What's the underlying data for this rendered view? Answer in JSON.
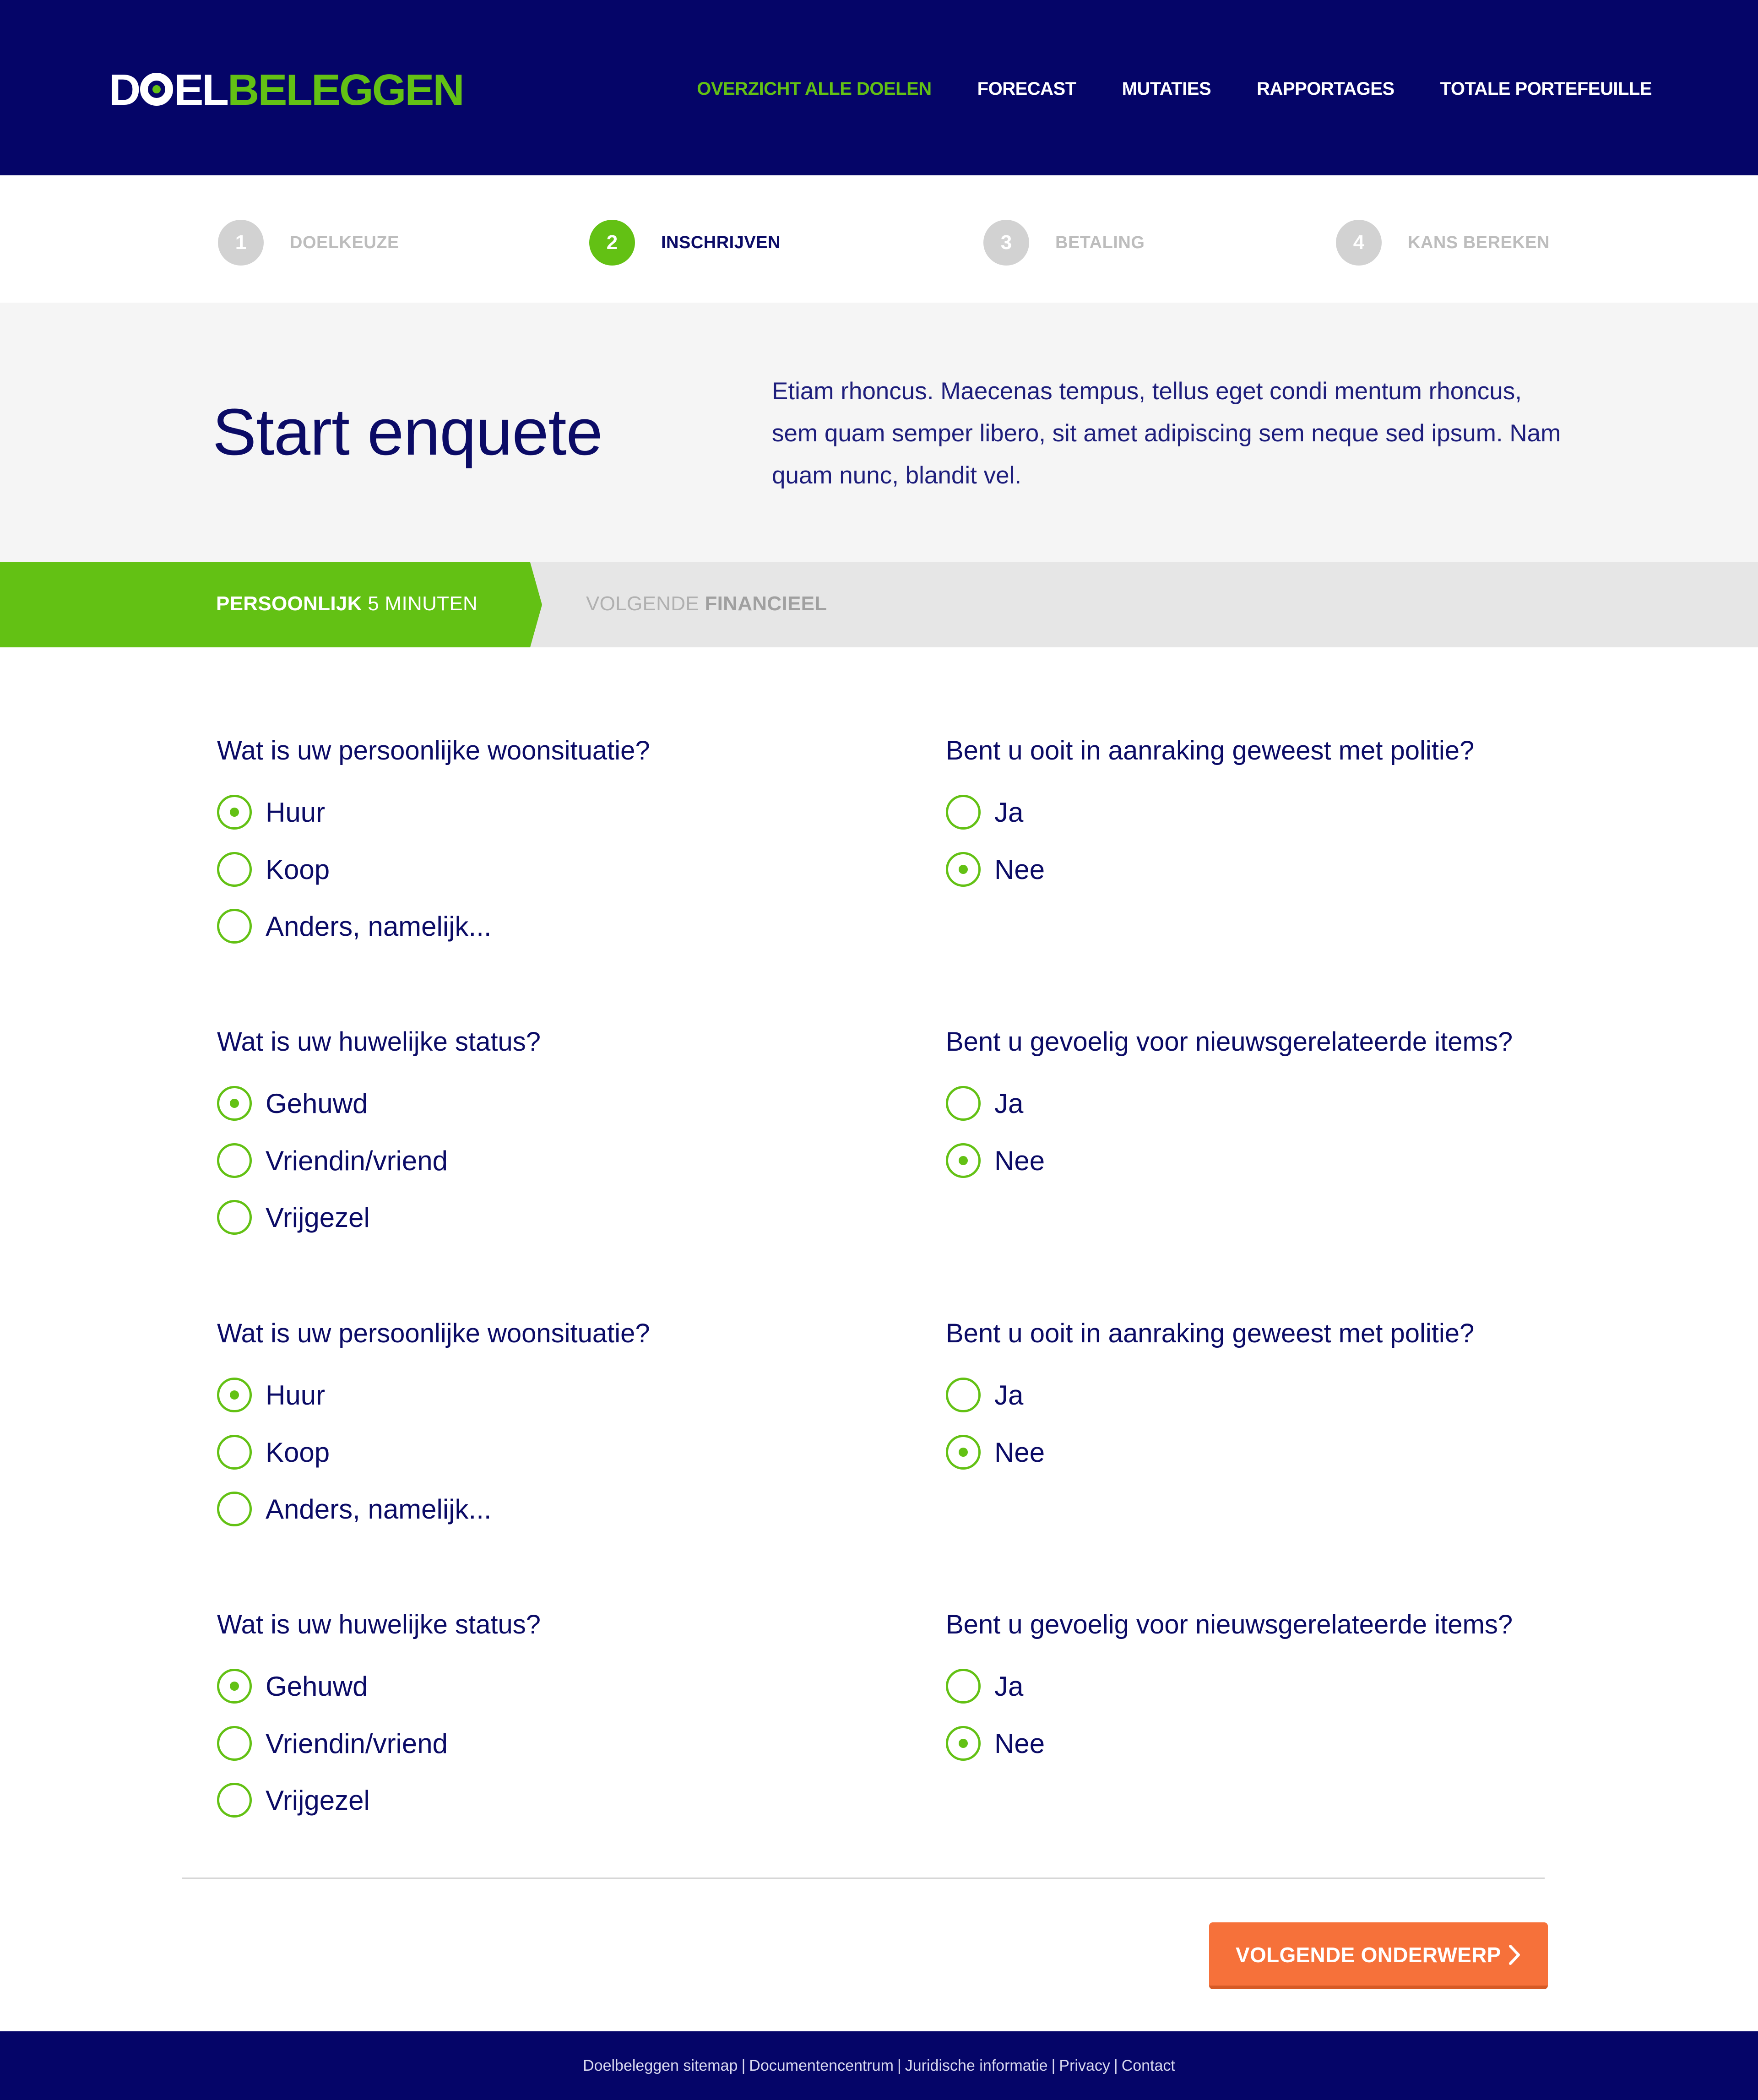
{
  "header": {
    "logo_part1": "DOEL",
    "logo_part2": "BELEGGEN",
    "nav": [
      {
        "label": "OVERZICHT ALLE DOELEN",
        "active": true
      },
      {
        "label": "FORECAST",
        "active": false
      },
      {
        "label": "MUTATIES",
        "active": false
      },
      {
        "label": "RAPPORTAGES",
        "active": false
      },
      {
        "label": "TOTALE PORTEFEUILLE",
        "active": false
      }
    ]
  },
  "steps": [
    {
      "num": "1",
      "label": "DOELKEUZE"
    },
    {
      "num": "2",
      "label": "INSCHRIJVEN"
    },
    {
      "num": "3",
      "label": "BETALING"
    },
    {
      "num": "4",
      "label": "KANS BEREKEN"
    }
  ],
  "hero": {
    "title": "Start enquete",
    "text": "Etiam rhoncus. Maecenas tempus, tellus eget condi mentum rhoncus, sem quam semper libero, sit amet adipiscing sem neque sed ipsum. Nam quam nunc, blandit vel."
  },
  "section": {
    "current_bold": "PERSOONLIJK",
    "current_rest": "5 MINUTEN",
    "next_prefix": "VOLGENDE",
    "next_bold": "FINANCIEEL"
  },
  "questions": [
    {
      "title": "Wat is uw persoonlijke woonsituatie?",
      "options": [
        "Huur",
        "Koop",
        "Anders, namelijk..."
      ],
      "selected": 0
    },
    {
      "title": "Bent u ooit in aanraking geweest met politie?",
      "options": [
        "Ja",
        "Nee"
      ],
      "selected": 1
    },
    {
      "title": "Wat is uw huwelijke status?",
      "options": [
        "Gehuwd",
        "Vriendin/vriend",
        "Vrijgezel"
      ],
      "selected": 0
    },
    {
      "title": "Bent u gevoelig voor nieuwsgerelateerde items?",
      "options": [
        "Ja",
        "Nee"
      ],
      "selected": 1
    },
    {
      "title": "Wat is uw persoonlijke woonsituatie?",
      "options": [
        "Huur",
        "Koop",
        "Anders, namelijk..."
      ],
      "selected": 0
    },
    {
      "title": "Bent u ooit in aanraking geweest met politie?",
      "options": [
        "Ja",
        "Nee"
      ],
      "selected": 1
    },
    {
      "title": "Wat is uw huwelijke status?",
      "options": [
        "Gehuwd",
        "Vriendin/vriend",
        "Vrijgezel"
      ],
      "selected": 0
    },
    {
      "title": "Bent u gevoelig voor nieuwsgerelateerde items?",
      "options": [
        "Ja",
        "Nee"
      ],
      "selected": 1
    }
  ],
  "next_button": {
    "label": "VOLGENDE ONDERWERP",
    "icon": "chevron-right-icon"
  },
  "footer": {
    "links": [
      "Doelbeleggen sitemap",
      "Documentencentrum",
      "Juridische informatie",
      "Privacy",
      "Contact"
    ],
    "separator": "|"
  },
  "colors": {
    "navy": "#050568",
    "green": "#63c114",
    "orange": "#f6713a",
    "hero_bg": "#f5f5f5",
    "section_bg": "#e6e6e6"
  }
}
